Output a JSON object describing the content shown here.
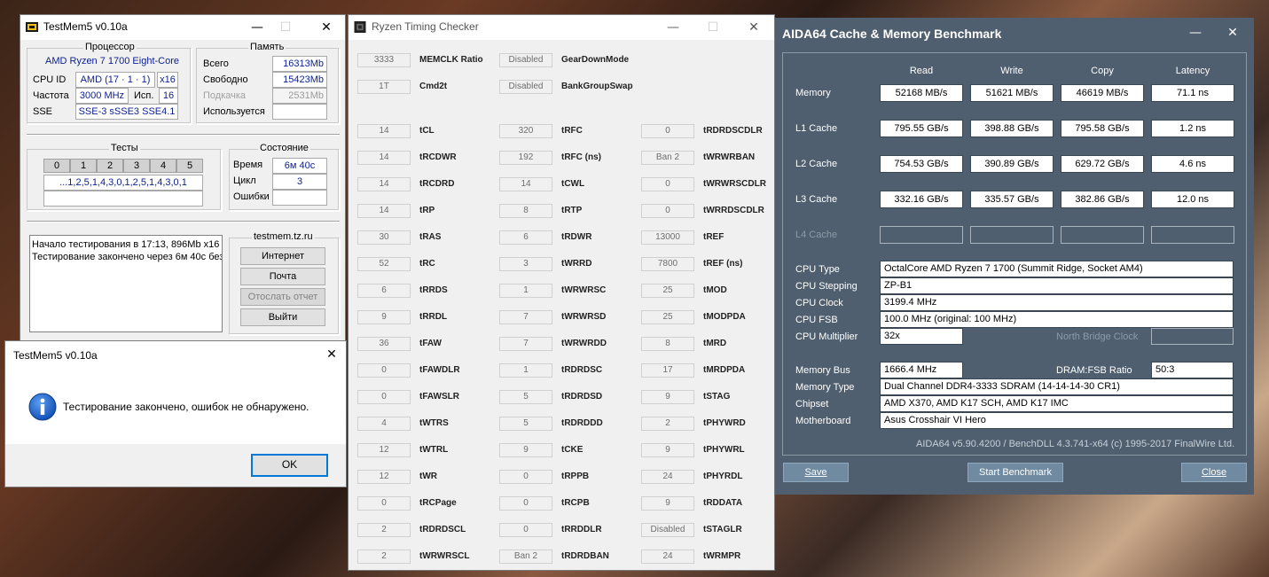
{
  "testmem": {
    "title": "TestMem5 v0.10a",
    "cpu_group": "Процессор",
    "cpu_name": "AMD Ryzen 7 1700 Eight-Core",
    "cpuid_label": "CPU ID",
    "cpuid_value": "AMD  (17 · 1 · 1)",
    "threads_value": "x16",
    "freq_label": "Частота",
    "freq_value": "3000 MHz",
    "used_threads_label": "Исп.",
    "used_threads_value": "16",
    "sse_label": "SSE",
    "sse_value": "SSE-3 sSSE3 SSE4.1",
    "mem_group": "Память",
    "total_label": "Всего",
    "total_value": "16313Mb",
    "free_label": "Свободно",
    "free_value": "15423Mb",
    "swap_label": "Подкачка",
    "swap_value": "2531Mb",
    "used_label": "Используется",
    "used_value": "",
    "tests_group": "Тесты",
    "test_headers": [
      "0",
      "1",
      "2",
      "3",
      "4",
      "5"
    ],
    "test_sequence": "...1,2,5,1,4,3,0,1,2,5,1,4,3,0,1",
    "status_group": "Состояние",
    "time_label": "Время",
    "time_value": "6м 40с",
    "cycle_label": "Цикл",
    "cycle_value": "3",
    "errors_label": "Ошибки",
    "errors_value": "",
    "log_line1": "Начало тестирования в 17:13, 896Mb x16",
    "log_line2": "Тестирование закончено через 6м 40с без",
    "site_group": "testmem.tz.ru",
    "btn_internet": "Интернет",
    "btn_mail": "Почта",
    "btn_report": "Отослать отчет",
    "btn_exit": "Выйти"
  },
  "dialog": {
    "title": "TestMem5 v0.10a",
    "message": "Тестирование закончено, ошибок не обнаружено.",
    "ok_label": "OK"
  },
  "rtc": {
    "title": "Ryzen Timing Checker",
    "top": [
      {
        "value": "3333",
        "label": "MEMCLK Ratio",
        "value2": "Disabled",
        "label2": "GearDownMode"
      },
      {
        "value": "1T",
        "label": "Cmd2t",
        "value2": "Disabled",
        "label2": "BankGroupSwap"
      }
    ],
    "rows": [
      [
        {
          "v": "14",
          "l": "tCL"
        },
        {
          "v": "320",
          "l": "tRFC"
        },
        {
          "v": "0",
          "l": "tRDRDSCDLR"
        }
      ],
      [
        {
          "v": "14",
          "l": "tRCDWR"
        },
        {
          "v": "192",
          "l": "tRFC (ns)"
        },
        {
          "v": "Ban 2",
          "l": "tWRWRBAN"
        }
      ],
      [
        {
          "v": "14",
          "l": "tRCDRD"
        },
        {
          "v": "14",
          "l": "tCWL"
        },
        {
          "v": "0",
          "l": "tWRWRSCDLR"
        }
      ],
      [
        {
          "v": "14",
          "l": "tRP"
        },
        {
          "v": "8",
          "l": "tRTP"
        },
        {
          "v": "0",
          "l": "tWRRDSCDLR"
        }
      ],
      [
        {
          "v": "30",
          "l": "tRAS"
        },
        {
          "v": "6",
          "l": "tRDWR"
        },
        {
          "v": "13000",
          "l": "tREF"
        }
      ],
      [
        {
          "v": "52",
          "l": "tRC"
        },
        {
          "v": "3",
          "l": "tWRRD"
        },
        {
          "v": "7800",
          "l": "tREF (ns)"
        }
      ],
      [
        {
          "v": "6",
          "l": "tRRDS"
        },
        {
          "v": "1",
          "l": "tWRWRSC"
        },
        {
          "v": "25",
          "l": "tMOD"
        }
      ],
      [
        {
          "v": "9",
          "l": "tRRDL"
        },
        {
          "v": "7",
          "l": "tWRWRSD"
        },
        {
          "v": "25",
          "l": "tMODPDA"
        }
      ],
      [
        {
          "v": "36",
          "l": "tFAW"
        },
        {
          "v": "7",
          "l": "tWRWRDD"
        },
        {
          "v": "8",
          "l": "tMRD"
        }
      ],
      [
        {
          "v": "0",
          "l": "tFAWDLR"
        },
        {
          "v": "1",
          "l": "tRDRDSC"
        },
        {
          "v": "17",
          "l": "tMRDPDA"
        }
      ],
      [
        {
          "v": "0",
          "l": "tFAWSLR"
        },
        {
          "v": "5",
          "l": "tRDRDSD"
        },
        {
          "v": "9",
          "l": "tSTAG"
        }
      ],
      [
        {
          "v": "4",
          "l": "tWTRS"
        },
        {
          "v": "5",
          "l": "tRDRDDD"
        },
        {
          "v": "2",
          "l": "tPHYWRD"
        }
      ],
      [
        {
          "v": "12",
          "l": "tWTRL"
        },
        {
          "v": "9",
          "l": "tCKE"
        },
        {
          "v": "9",
          "l": "tPHYWRL"
        }
      ],
      [
        {
          "v": "12",
          "l": "tWR"
        },
        {
          "v": "0",
          "l": "tRPPB"
        },
        {
          "v": "24",
          "l": "tPHYRDL"
        }
      ],
      [
        {
          "v": "0",
          "l": "tRCPage"
        },
        {
          "v": "0",
          "l": "tRCPB"
        },
        {
          "v": "9",
          "l": "tRDDATA"
        }
      ],
      [
        {
          "v": "2",
          "l": "tRDRDSCL"
        },
        {
          "v": "0",
          "l": "tRRDDLR"
        },
        {
          "v": "Disabled",
          "l": "tSTAGLR"
        }
      ],
      [
        {
          "v": "2",
          "l": "tWRWRSCL"
        },
        {
          "v": "Ban 2",
          "l": "tRDRDBAN"
        },
        {
          "v": "24",
          "l": "tWRMPR"
        }
      ]
    ]
  },
  "aida": {
    "title": "AIDA64 Cache & Memory Benchmark",
    "columns": [
      "Read",
      "Write",
      "Copy",
      "Latency"
    ],
    "rows": [
      {
        "label": "Memory",
        "values": [
          "52168 MB/s",
          "51621 MB/s",
          "46619 MB/s",
          "71.1 ns"
        ]
      },
      {
        "label": "L1 Cache",
        "values": [
          "795.55 GB/s",
          "398.88 GB/s",
          "795.58 GB/s",
          "1.2 ns"
        ]
      },
      {
        "label": "L2 Cache",
        "values": [
          "754.53 GB/s",
          "390.89 GB/s",
          "629.72 GB/s",
          "4.6 ns"
        ]
      },
      {
        "label": "L3 Cache",
        "values": [
          "332.16 GB/s",
          "335.57 GB/s",
          "382.86 GB/s",
          "12.0 ns"
        ]
      },
      {
        "label": "L4 Cache",
        "values": [
          "",
          "",
          "",
          ""
        ]
      }
    ],
    "cpu_type_label": "CPU Type",
    "cpu_type": "OctalCore AMD Ryzen 7 1700  (Summit Ridge, Socket AM4)",
    "cpu_stepping_label": "CPU Stepping",
    "cpu_stepping": "ZP-B1",
    "cpu_clock_label": "CPU Clock",
    "cpu_clock": "3199.4 MHz",
    "cpu_fsb_label": "CPU FSB",
    "cpu_fsb": "100.0 MHz  (original: 100 MHz)",
    "cpu_mult_label": "CPU Multiplier",
    "cpu_mult": "32x",
    "nb_clock_label": "North Bridge Clock",
    "nb_clock": "",
    "mem_bus_label": "Memory Bus",
    "mem_bus": "1666.4 MHz",
    "dram_fsb_label": "DRAM:FSB Ratio",
    "dram_fsb": "50:3",
    "mem_type_label": "Memory Type",
    "mem_type": "Dual Channel DDR4-3333 SDRAM  (14-14-14-30 CR1)",
    "chipset_label": "Chipset",
    "chipset": "AMD X370, AMD K17 SCH, AMD K17 IMC",
    "mobo_label": "Motherboard",
    "mobo": "Asus Crosshair VI Hero",
    "footer": "AIDA64 v5.90.4200 / BenchDLL 4.3.741-x64  (c) 1995-2017 FinalWire Ltd.",
    "btn_save": "Save",
    "btn_start": "Start Benchmark",
    "btn_close": "Close"
  }
}
